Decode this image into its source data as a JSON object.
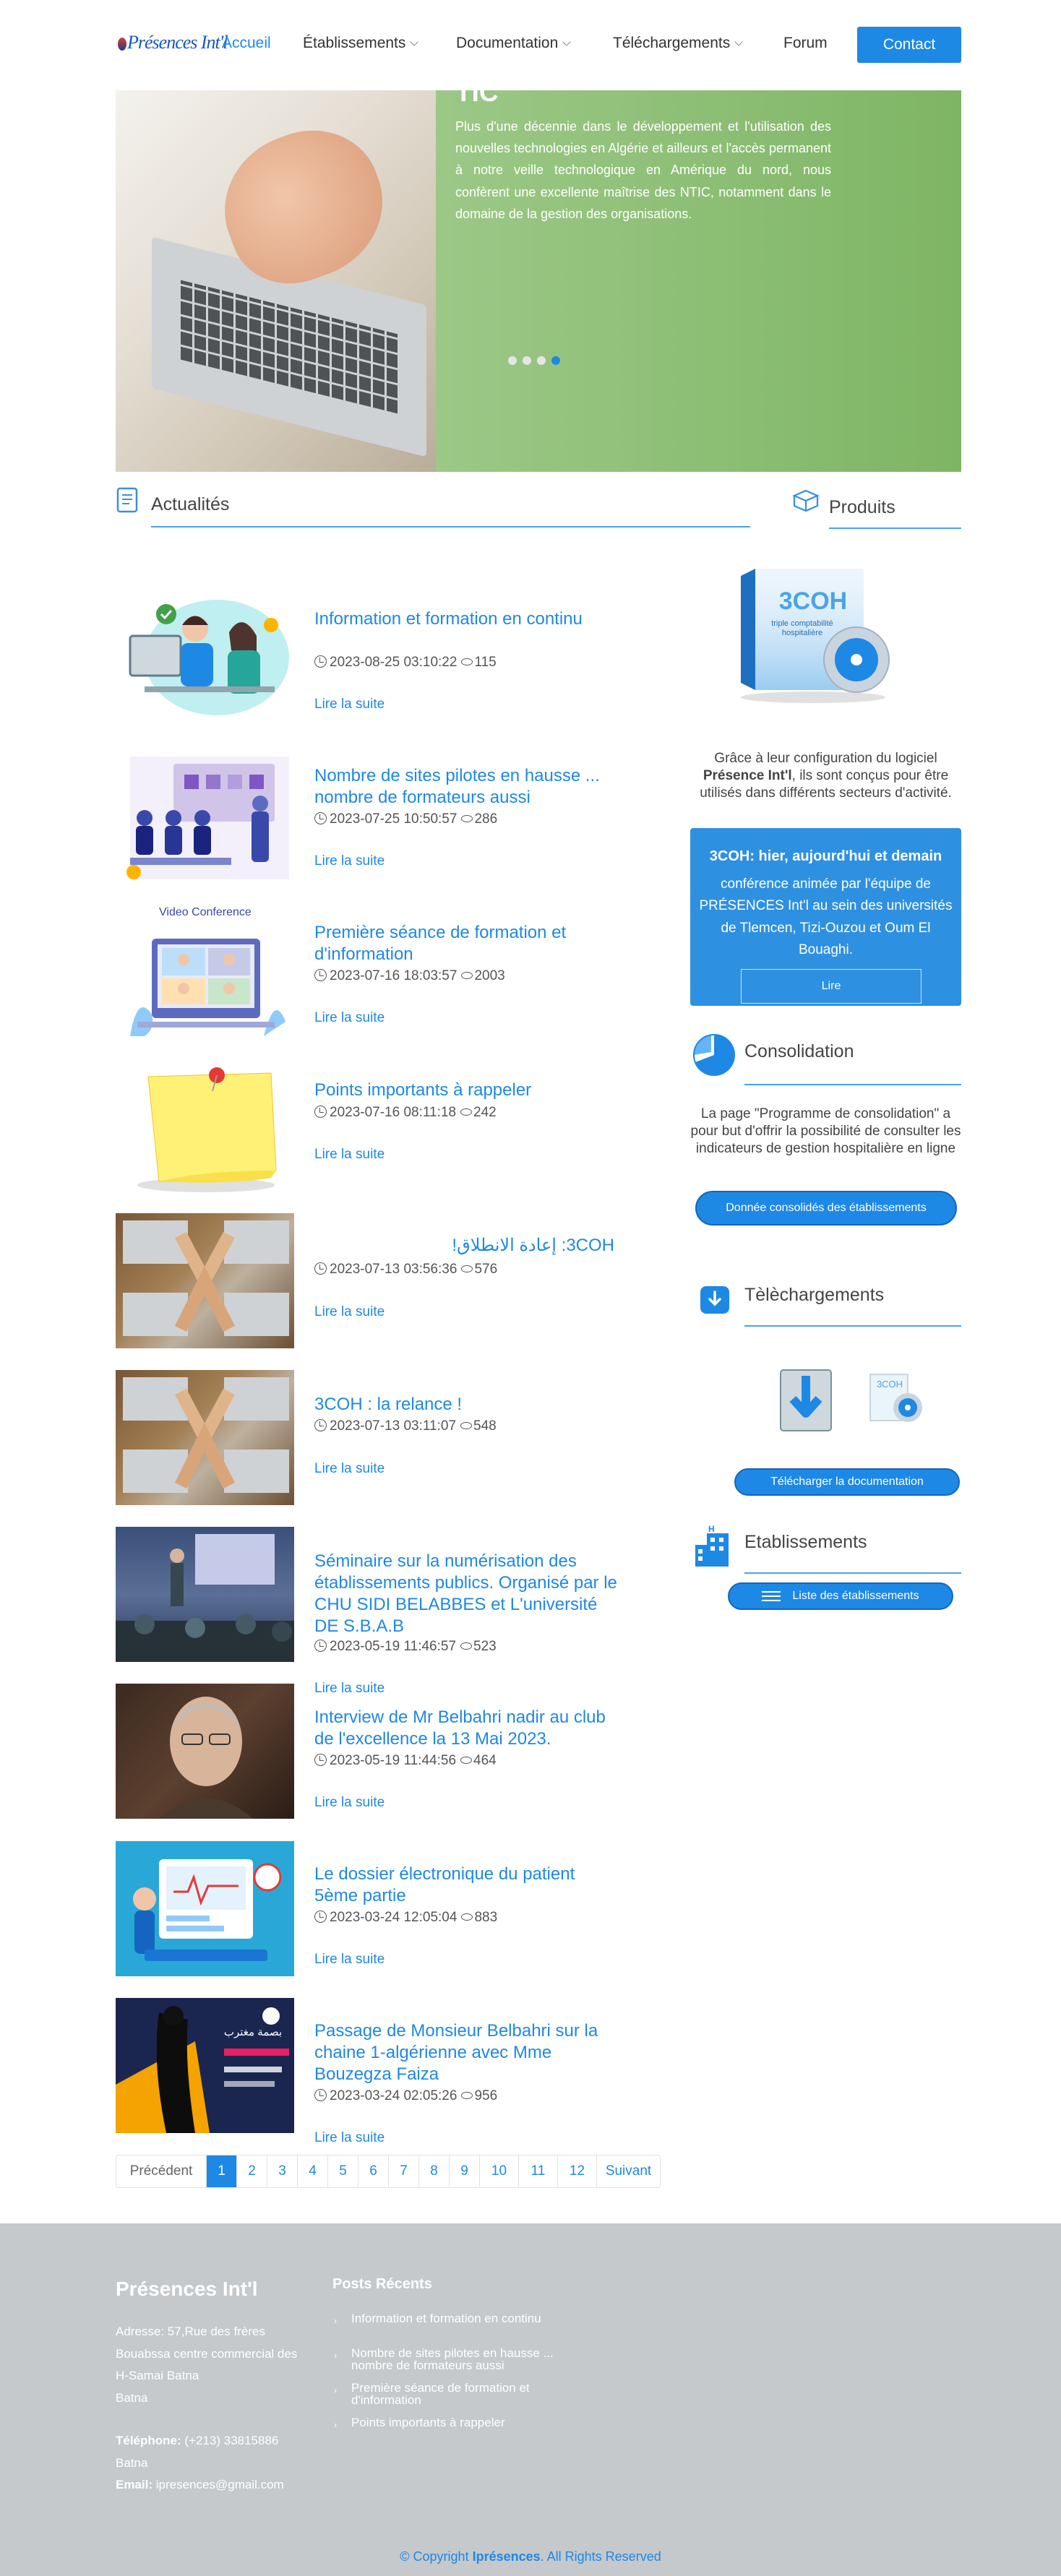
{
  "header": {
    "logo_text": "Présences Int'l",
    "nav": [
      {
        "label": "Accueil",
        "active": true,
        "dropdown": false
      },
      {
        "label": "Établissements",
        "active": false,
        "dropdown": true
      },
      {
        "label": "Documentation",
        "active": false,
        "dropdown": true
      },
      {
        "label": "Téléchargements",
        "active": false,
        "dropdown": true
      },
      {
        "label": "Forum",
        "active": false,
        "dropdown": false
      }
    ],
    "contact_label": "Contact"
  },
  "hero": {
    "title": "Une maîtrise des nouvelles TIC",
    "text": "Plus d'une décennie dans le développement et l'utilisation des nouvelles technologies en Algérie et ailleurs et l'accès permanent à notre veille technologique en Amérique du nord, nous confèrent une excellente maîtrise des NTIC, notamment dans le domaine de la gestion des organisations.",
    "slides_total": 4,
    "active_slide": 4
  },
  "news": {
    "section_title": "Actualités",
    "read_more": "Lire la suite",
    "items": [
      {
        "title": "Information et formation en continu",
        "date": "2023-08-25 03:10:22",
        "views": "115"
      },
      {
        "title": "Nombre de sites pilotes en hausse ... nombre de formateurs aussi",
        "date": "2023-07-25 10:50:57",
        "views": "286"
      },
      {
        "title": "Première séance de formation et d'information",
        "date": "2023-07-16 18:03:57",
        "views": "2003",
        "thumb_caption": "Video Conference"
      },
      {
        "title": "Points importants à rappeler",
        "date": "2023-07-16 08:11:18",
        "views": "242"
      },
      {
        "title": "3COH: إعادة الانطلاق!",
        "date": "2023-07-13 03:56:36",
        "views": "576"
      },
      {
        "title": "3COH : la relance !",
        "date": "2023-07-13 03:11:07",
        "views": "548"
      },
      {
        "title": "Séminaire sur la numérisation des établissements publics. Organisé par le CHU SIDI BELABBES et L'université DE S.B.A.B",
        "date": "2023-05-19 11:46:57",
        "views": "523"
      },
      {
        "title": "Interview de Mr Belbahri nadir au club de l'excellence la 13 Mai 2023.",
        "date": "2023-05-19 11:44:56",
        "views": "464"
      },
      {
        "title": "Le dossier électronique du patient 5ème partie",
        "date": "2023-03-24 12:05:04",
        "views": "883"
      },
      {
        "title": "Passage de Monsieur Belbahri sur la chaine 1-algérienne avec Mme Bouzegza Faiza",
        "date": "2023-03-24 02:05:26",
        "views": "956",
        "thumb_text": "بصمة مغترب"
      }
    ]
  },
  "pagination": {
    "prev": "Précédent",
    "pages": [
      "1",
      "2",
      "3",
      "4",
      "5",
      "6",
      "7",
      "8",
      "9",
      "10",
      "11",
      "12"
    ],
    "current": "1",
    "next": "Suivant"
  },
  "sidebar": {
    "produits": {
      "title": "Produits",
      "box_label": "3COH",
      "box_sub": "triple comptabilité hospitalière",
      "desc_pre": "Grâce à leur configuration du logiciel ",
      "desc_bold": "Présence Int'l",
      "desc_post": ", ils sont conçus pour être utilisés dans différents secteurs d'activité."
    },
    "promo": {
      "title": "3COH: hier, aujourd'hui et demain",
      "text": "conférence animée par l'équipe de PRÉSENCES Int'l au sein des universités de Tlemcen, Tizi-Ouzou et Oum El Bouaghi.",
      "button": "Lire"
    },
    "consolidation": {
      "title": "Consolidation",
      "text": "La page \"Programme de consolidation\" a pour but d'offrir la possibilité de consulter les indicateurs de gestion hospitalière en ligne",
      "button": "Donnée consolidés des établissements"
    },
    "telechargements": {
      "title": "Tèlèchargements",
      "box_label": "3COH",
      "button": "Télécharger la documentation"
    },
    "etablissements": {
      "title": "Etablissements",
      "button": "Liste des établissements"
    }
  },
  "footer": {
    "brand": "Présences Int'l",
    "address_lines": [
      "Adresse: 57,Rue des frères",
      "Bouabssa centre commercial des",
      "H-Samai Batna",
      "Batna"
    ],
    "phone_label": "Téléphone:",
    "phone": "(+213) 33815886",
    "city": "Batna",
    "email_label": "Email:",
    "email": "ipresences@gmail.com",
    "posts_title": "Posts Récents",
    "posts": [
      "Information et formation en continu",
      "Nombre de sites pilotes en hausse ... nombre de formateurs aussi",
      "Première séance de formation et d'information",
      "Points importants à rappeler"
    ],
    "copyright_pre": "© Copyright ",
    "copyright_brand": "Iprésences",
    "copyright_post": ". All Rights Reserved"
  },
  "colors": {
    "accent": "#1e88e5",
    "hero_green": "#8cbf72",
    "footer_bg": "#c5c9cc",
    "promo_box": "#2e90e0"
  }
}
